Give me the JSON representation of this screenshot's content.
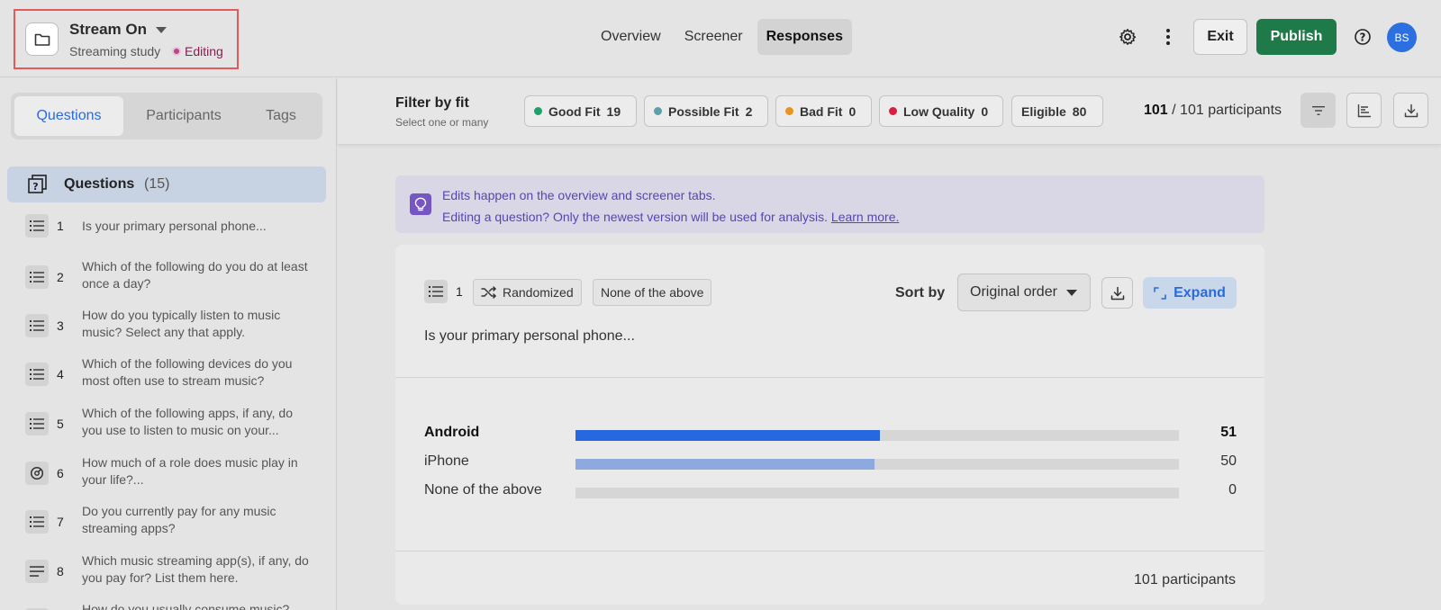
{
  "header": {
    "study_title": "Stream On",
    "study_subtitle": "Streaming study",
    "status": "Editing",
    "nav": [
      {
        "label": "Overview",
        "active": false
      },
      {
        "label": "Screener",
        "active": false
      },
      {
        "label": "Responses",
        "active": true
      }
    ],
    "exit_label": "Exit",
    "publish_label": "Publish",
    "avatar_initials": "BS",
    "colors": {
      "publish": "#1f7a4a",
      "avatar": "#2c6fe0",
      "accent": "#2b6bd8"
    }
  },
  "sidebar": {
    "tabs": [
      {
        "label": "Questions",
        "active": true
      },
      {
        "label": "Participants",
        "active": false
      },
      {
        "label": "Tags",
        "active": false
      }
    ],
    "questions_header": {
      "label": "Questions",
      "count": "(15)"
    },
    "questions": [
      {
        "num": "1",
        "icon": "list-icon",
        "text": "Is your primary personal phone..."
      },
      {
        "num": "2",
        "icon": "list-icon",
        "text": "Which of the following do you do at least once a day?"
      },
      {
        "num": "3",
        "icon": "list-icon",
        "text": "How do you typically listen to music music? Select any that apply."
      },
      {
        "num": "4",
        "icon": "list-icon",
        "text": "Which of the following devices do you most often use to stream music?"
      },
      {
        "num": "5",
        "icon": "list-icon",
        "text": "Which of the following apps, if any, do you use to listen to music on your..."
      },
      {
        "num": "6",
        "icon": "gauge-icon",
        "text": "How much of a role does music play in your life?..."
      },
      {
        "num": "7",
        "icon": "list-icon",
        "text": "Do you currently pay for any music streaming apps?"
      },
      {
        "num": "8",
        "icon": "text-lines-icon",
        "text": "Which music streaming app(s), if any, do you pay for? List them here."
      },
      {
        "num": "",
        "icon": "list-icon",
        "text": "How do you usually consume music?"
      }
    ]
  },
  "filter": {
    "title": "Filter by fit",
    "subtitle": "Select one or many",
    "chips": [
      {
        "label": "Good Fit",
        "count": "19",
        "color": "#22a06b"
      },
      {
        "label": "Possible Fit",
        "count": "2",
        "color": "#5fa0a8"
      },
      {
        "label": "Bad Fit",
        "count": "0",
        "color": "#e8951e"
      },
      {
        "label": "Low Quality",
        "count": "0",
        "color": "#d9213f"
      },
      {
        "label": "Eligible",
        "count": "80",
        "color": ""
      }
    ],
    "participants_shown": "101",
    "participants_total": "/ 101 participants"
  },
  "info": {
    "line1": "Edits happen on the overview and screener tabs.",
    "line2": "Editing a question? Only the newest version will be used for analysis.",
    "link": "Learn more."
  },
  "question_card": {
    "number": "1",
    "tags": [
      "Randomized",
      "None of the above"
    ],
    "sort_label": "Sort by",
    "sort_value": "Original order",
    "expand_label": "Expand",
    "question": "Is your primary personal phone...",
    "footer": "101 participants"
  },
  "chart_data": {
    "type": "bar",
    "orientation": "horizontal",
    "categories": [
      "Android",
      "iPhone",
      "None of the above"
    ],
    "values": [
      51,
      50,
      0
    ],
    "total": 101,
    "colors": [
      "#2767e0",
      "#8ea9de",
      "#d6d6d6"
    ]
  }
}
